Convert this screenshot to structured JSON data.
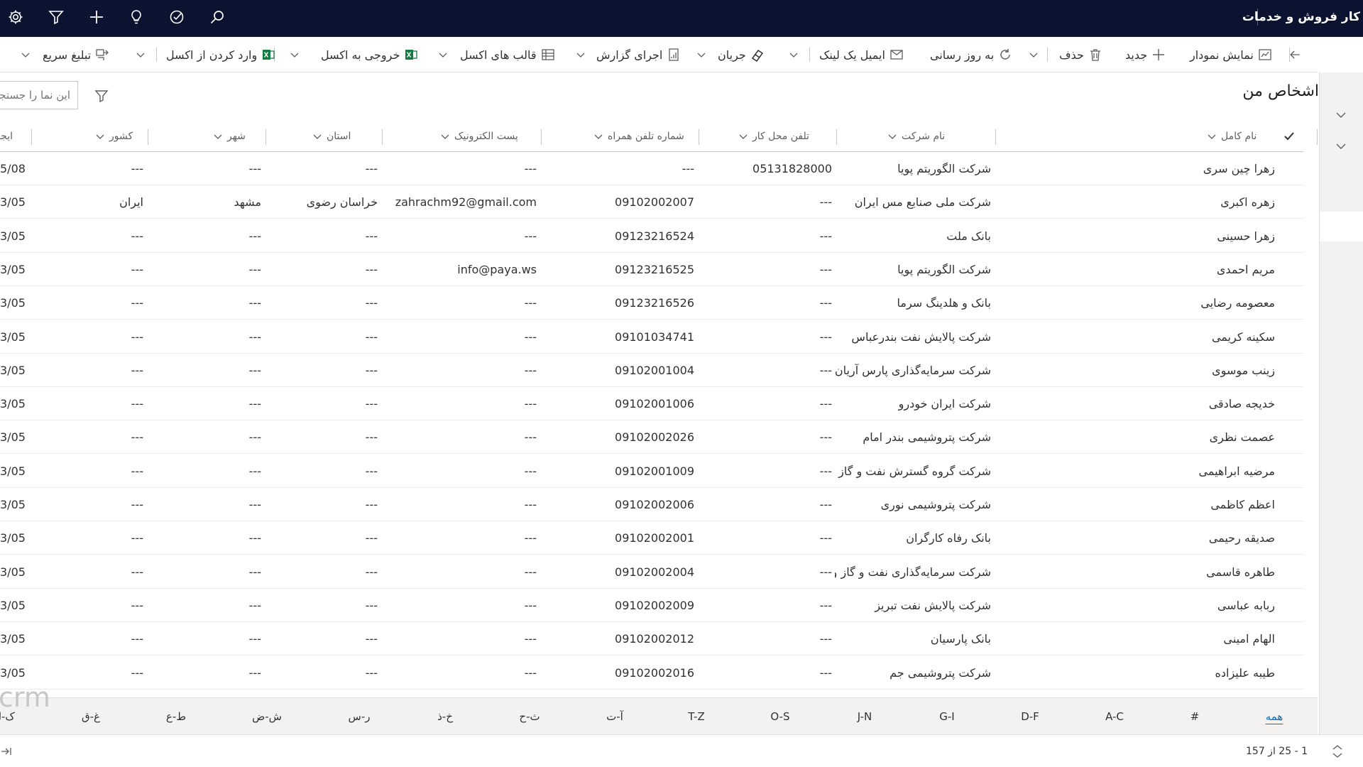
{
  "app": {
    "title": "کار فروش و خدمات"
  },
  "commands": {
    "show_chart": "نمایش نمودار",
    "new": "جدید",
    "delete": "حذف",
    "refresh": "به روز رسانی",
    "email_link": "ایمیل یک لینک",
    "flow": "جریان",
    "run_report": "اجرای گزارش",
    "excel_templates": "قالب های اکسل",
    "export_excel": "خروجی به اکسل",
    "import_excel": "وارد کردن از اکسل",
    "quick_campaign": "تبلیغ سریع"
  },
  "view": {
    "title": "اشخاص من",
    "search_placeholder": "این نما را جستجو کنید"
  },
  "columns": {
    "full_name": "نام کامل",
    "company": "نام شرکت",
    "business_phone": "تلفن محل کار",
    "mobile_phone": "شماره تلفن همراه",
    "email": "پست الکترونیک",
    "state": "استان",
    "city": "شهر",
    "country": "کشور",
    "created_on": "ایجاد د"
  },
  "rows": [
    {
      "full_name": "زهرا چین سری",
      "company": "شرکت الگوریتم پویا",
      "business_phone": "05131828000",
      "mobile_phone": "---",
      "email": "---",
      "state": "---",
      "city": "---",
      "country": "---",
      "created_on": "5/08"
    },
    {
      "full_name": "زهره اکبری",
      "company": "شرکت ملی صنایع مس ایران",
      "business_phone": "---",
      "mobile_phone": "09102002007",
      "email": "zahrachm92@gmail.com",
      "state": "خراسان رضوی",
      "city": "مشهد",
      "country": "ایران",
      "created_on": "3/05"
    },
    {
      "full_name": "زهرا حسینی",
      "company": "بانک ملت",
      "business_phone": "---",
      "mobile_phone": "09123216524",
      "email": "---",
      "state": "---",
      "city": "---",
      "country": "---",
      "created_on": "3/05"
    },
    {
      "full_name": "مریم احمدی",
      "company": "شرکت الگوریتم پویا",
      "business_phone": "---",
      "mobile_phone": "09123216525",
      "email": "info@paya.ws",
      "state": "---",
      "city": "---",
      "country": "---",
      "created_on": "3/05"
    },
    {
      "full_name": "معصومه رضایی",
      "company": "بانک و هلدینگ سرما",
      "business_phone": "---",
      "mobile_phone": "09123216526",
      "email": "---",
      "state": "---",
      "city": "---",
      "country": "---",
      "created_on": "3/05"
    },
    {
      "full_name": "سکینه کریمی",
      "company": "شرکت پالایش نفت بندرعباس",
      "business_phone": "---",
      "mobile_phone": "09101034741",
      "email": "---",
      "state": "---",
      "city": "---",
      "country": "---",
      "created_on": "3/05"
    },
    {
      "full_name": "زینب موسوی",
      "company": "شرکت سرمایه‌گذاری پارس آریان",
      "business_phone": "---",
      "mobile_phone": "09102001004",
      "email": "---",
      "state": "---",
      "city": "---",
      "country": "---",
      "created_on": "3/05"
    },
    {
      "full_name": "خدیجه صادقی",
      "company": "شرکت ایران خودرو",
      "business_phone": "---",
      "mobile_phone": "09102001006",
      "email": "---",
      "state": "---",
      "city": "---",
      "country": "---",
      "created_on": "3/05"
    },
    {
      "full_name": "عصمت نظری",
      "company": "شرکت پتروشیمی بندر امام",
      "business_phone": "---",
      "mobile_phone": "09102002026",
      "email": "---",
      "state": "---",
      "city": "---",
      "country": "---",
      "created_on": "3/05"
    },
    {
      "full_name": "مرضیه ابراهیمی",
      "company": "شرکت گروه گسترش نفت و گاز پارسیان",
      "business_phone": "---",
      "mobile_phone": "09102001009",
      "email": "---",
      "state": "---",
      "city": "---",
      "country": "---",
      "created_on": "3/05"
    },
    {
      "full_name": "اعظم کاظمی",
      "company": "شرکت پتروشیمی نوری",
      "business_phone": "---",
      "mobile_phone": "09102002006",
      "email": "---",
      "state": "---",
      "city": "---",
      "country": "---",
      "created_on": "3/05"
    },
    {
      "full_name": "صدیقه رحیمی",
      "company": "بانک رفاه کارگران",
      "business_phone": "---",
      "mobile_phone": "09102002001",
      "email": "---",
      "state": "---",
      "city": "---",
      "country": "---",
      "created_on": "3/05"
    },
    {
      "full_name": "طاهره قاسمی",
      "company": "شرکت سرمایه‌گذاری نفت و گاز و پتروشیمی",
      "business_phone": "---",
      "mobile_phone": "09102002004",
      "email": "---",
      "state": "---",
      "city": "---",
      "country": "---",
      "created_on": "3/05"
    },
    {
      "full_name": "ربابه عباسی",
      "company": "شرکت پالایش نفت تبریز",
      "business_phone": "---",
      "mobile_phone": "09102002009",
      "email": "---",
      "state": "---",
      "city": "---",
      "country": "---",
      "created_on": "3/05"
    },
    {
      "full_name": "الهام امینی",
      "company": "بانک پارسیان",
      "business_phone": "---",
      "mobile_phone": "09102002012",
      "email": "---",
      "state": "---",
      "city": "---",
      "country": "---",
      "created_on": "3/05"
    },
    {
      "full_name": "طیبه علیزاده",
      "company": "شرکت پتروشیمی جم",
      "business_phone": "---",
      "mobile_phone": "09102002016",
      "email": "---",
      "state": "---",
      "city": "---",
      "country": "---",
      "created_on": "3/05"
    }
  ],
  "jump_bar": [
    "همه",
    "#",
    "A-C",
    "D-F",
    "G-I",
    "J-N",
    "O-S",
    "T-Z",
    "آ-ت",
    "ث-ح",
    "خ-ذ",
    "ر-س",
    "ش-ض",
    "ط-ع",
    "غ-ق",
    "ک-ل"
  ],
  "watermark": "crm",
  "footer": {
    "count": "1 - 25 از 157"
  },
  "colors": {
    "topbar": "#0b1330",
    "accent": "#0f6cbd",
    "excel_green": "#107c41"
  }
}
